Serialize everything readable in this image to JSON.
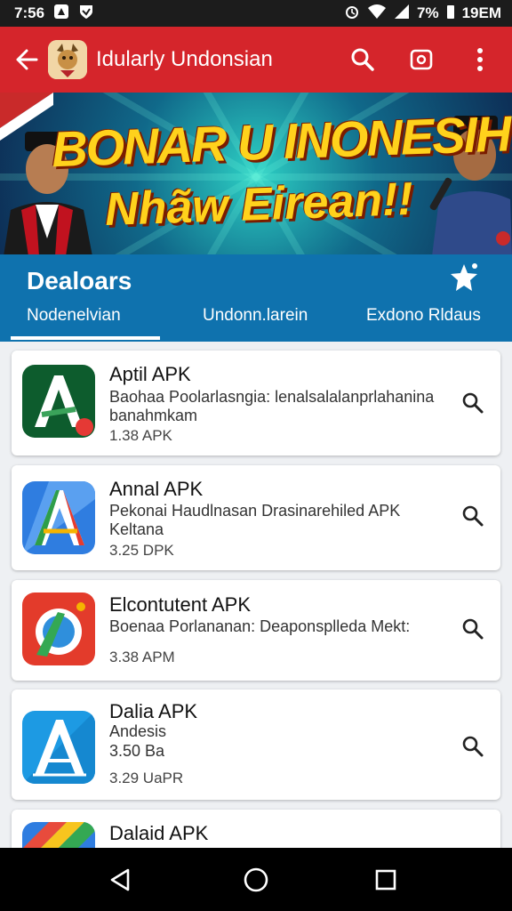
{
  "status_bar": {
    "time": "7:56",
    "battery": "7%",
    "clock_right": "19EM"
  },
  "app_bar": {
    "title": "Idularly Undonsian",
    "icons": [
      "back-arrow-icon",
      "app-logo",
      "search-icon",
      "camera-icon",
      "more-vert-icon"
    ]
  },
  "banner": {
    "line1": "BONAR U INONESIH!",
    "line2": "Nhãw Eirean!!"
  },
  "section": {
    "title": "Dealoars",
    "tabs": [
      "Nodenelvian",
      "Undonn.larein",
      "Exdono Rldaus"
    ],
    "selected_tab": 0
  },
  "apps": [
    {
      "name": "Aptil APK",
      "desc_line1": "Baohaa Poolarlasngia: lenalsalalanprlahanina",
      "desc_line2": "banahmkam",
      "size": "1.38 APK",
      "colors": [
        "#0c5a2c",
        "#1e8a45"
      ]
    },
    {
      "name": "Annal APK",
      "desc_line1": "Pekonai Haudlnasan Drasinarehiled APK",
      "desc_line2": "Keltana",
      "size": "3.25 DPK",
      "colors": [
        "#3a7fe0",
        "#1f4fbf"
      ]
    },
    {
      "name": "Elcontutent APK",
      "desc_line1": "Boenaa Porlananan: Deaponsplleda Mekt:",
      "desc_line2": "",
      "size": "3.38 APM",
      "colors": [
        "#e53d2d",
        "#f0592f"
      ]
    },
    {
      "name": "Dalia APK",
      "desc_line1": "Andesis",
      "desc_line2": "3.50 Ba",
      "size": "3.29 UaPR",
      "colors": [
        "#22a0e5",
        "#1788cf"
      ]
    },
    {
      "name": "Dalaid APK",
      "desc_line1": "",
      "desc_line2": "",
      "size": "",
      "colors": [
        "#e84b3c",
        "#f7c51e"
      ]
    }
  ],
  "nav_bar": {
    "icons": [
      "back-triangle-icon",
      "home-circle-icon",
      "recents-square-icon"
    ]
  }
}
